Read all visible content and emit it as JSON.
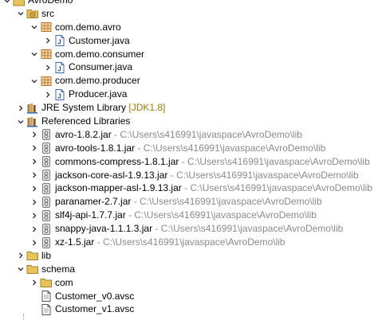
{
  "tree": [
    {
      "depth": 0,
      "toggle": "open",
      "icon": "project",
      "label": "AvroDemo"
    },
    {
      "depth": 1,
      "toggle": "open",
      "icon": "srcfolder",
      "label": "src"
    },
    {
      "depth": 2,
      "toggle": "open",
      "icon": "package",
      "label": "com.demo.avro"
    },
    {
      "depth": 3,
      "toggle": "closed",
      "icon": "java",
      "label": "Customer.java"
    },
    {
      "depth": 2,
      "toggle": "open",
      "icon": "package",
      "label": "com.demo.consumer"
    },
    {
      "depth": 3,
      "toggle": "closed",
      "icon": "java",
      "label": "Consumer.java"
    },
    {
      "depth": 2,
      "toggle": "open",
      "icon": "package",
      "label": "com.demo.producer"
    },
    {
      "depth": 3,
      "toggle": "closed",
      "icon": "java",
      "label": "Producer.java"
    },
    {
      "depth": 1,
      "toggle": "closed",
      "icon": "library",
      "label": "JRE System Library",
      "suffix": "[JDK1.8]",
      "suffixStyle": "jre"
    },
    {
      "depth": 1,
      "toggle": "open",
      "icon": "library",
      "label": "Referenced Libraries"
    },
    {
      "depth": 2,
      "toggle": "closed",
      "icon": "jar",
      "label": "avro-1.8.2.jar",
      "suffix": " - C:\\Users\\s416991\\javaspace\\AvroDemo\\lib",
      "suffixStyle": "gray"
    },
    {
      "depth": 2,
      "toggle": "closed",
      "icon": "jar",
      "label": "avro-tools-1.8.1.jar",
      "suffix": " - C:\\Users\\s416991\\javaspace\\AvroDemo\\lib",
      "suffixStyle": "gray"
    },
    {
      "depth": 2,
      "toggle": "closed",
      "icon": "jar",
      "label": "commons-compress-1.8.1.jar",
      "suffix": " - C:\\Users\\s416991\\javaspace\\AvroDemo\\lib",
      "suffixStyle": "gray"
    },
    {
      "depth": 2,
      "toggle": "closed",
      "icon": "jar",
      "label": "jackson-core-asl-1.9.13.jar",
      "suffix": " - C:\\Users\\s416991\\javaspace\\AvroDemo\\lib",
      "suffixStyle": "gray"
    },
    {
      "depth": 2,
      "toggle": "closed",
      "icon": "jar",
      "label": "jackson-mapper-asl-1.9.13.jar",
      "suffix": " - C:\\Users\\s416991\\javaspace\\AvroDemo\\lib",
      "suffixStyle": "gray"
    },
    {
      "depth": 2,
      "toggle": "closed",
      "icon": "jar",
      "label": "paranamer-2.7.jar",
      "suffix": " - C:\\Users\\s416991\\javaspace\\AvroDemo\\lib",
      "suffixStyle": "gray"
    },
    {
      "depth": 2,
      "toggle": "closed",
      "icon": "jar",
      "label": "slf4j-api-1.7.7.jar",
      "suffix": " - C:\\Users\\s416991\\javaspace\\AvroDemo\\lib",
      "suffixStyle": "gray"
    },
    {
      "depth": 2,
      "toggle": "closed",
      "icon": "jar",
      "label": "snappy-java-1.1.1.3.jar",
      "suffix": " - C:\\Users\\s416991\\javaspace\\AvroDemo\\lib",
      "suffixStyle": "gray"
    },
    {
      "depth": 2,
      "toggle": "closed",
      "icon": "jar",
      "label": "xz-1.5.jar",
      "suffix": " - C:\\Users\\s416991\\javaspace\\AvroDemo\\lib",
      "suffixStyle": "gray"
    },
    {
      "depth": 1,
      "toggle": "closed",
      "icon": "folder",
      "label": "lib"
    },
    {
      "depth": 1,
      "toggle": "open",
      "icon": "folder",
      "label": "schema"
    },
    {
      "depth": 2,
      "toggle": "closed",
      "icon": "folder",
      "label": "com"
    },
    {
      "depth": 2,
      "toggle": "none",
      "icon": "file",
      "label": "Customer_v0.avsc"
    },
    {
      "depth": 2,
      "toggle": "none",
      "icon": "file",
      "label": "Customer_v1.avsc"
    }
  ]
}
